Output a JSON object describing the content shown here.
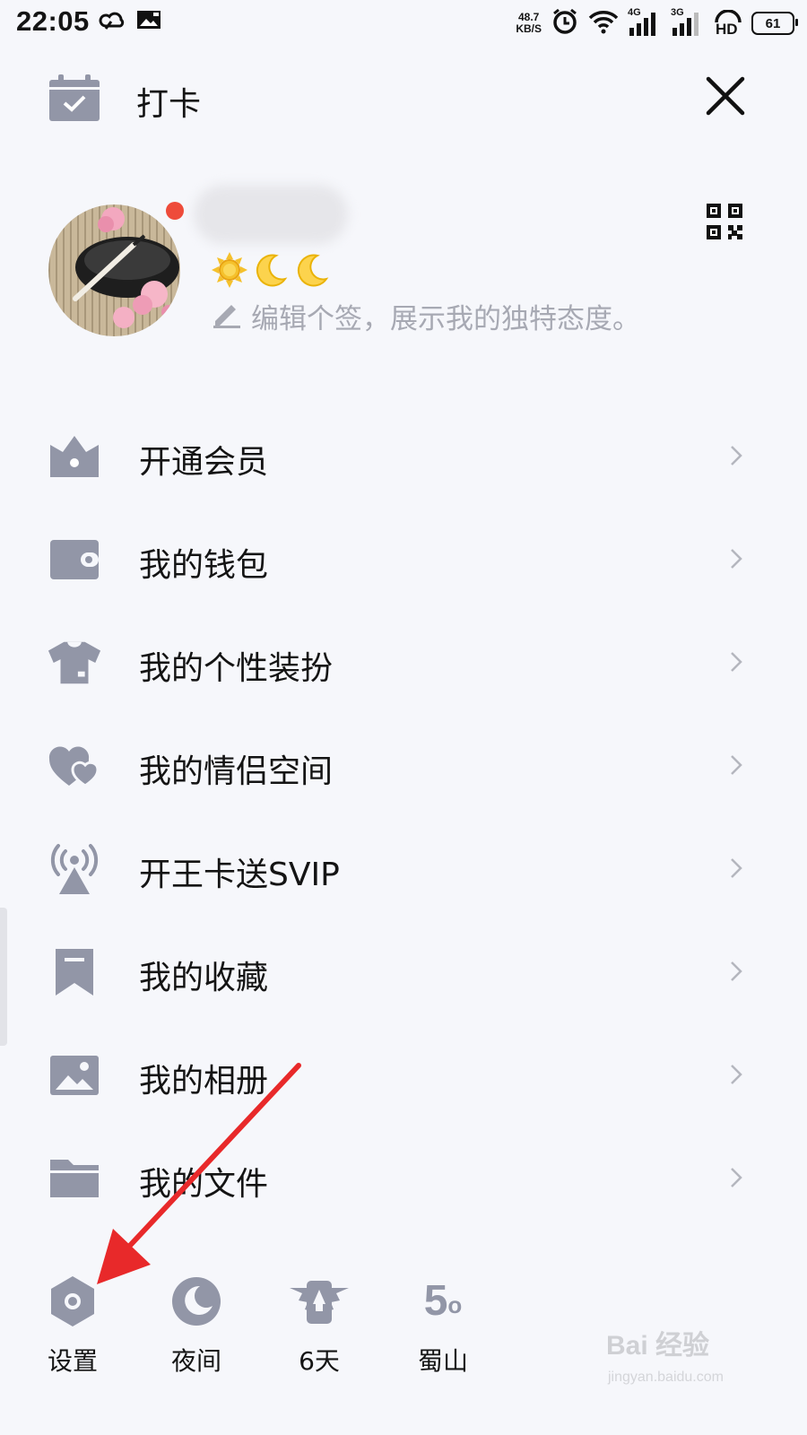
{
  "status_bar": {
    "time": "22:05",
    "net_speed_value": "48.7",
    "net_speed_unit": "KB/S",
    "signal1_label": "4G",
    "signal2_label": "3G",
    "hd_label": "HD",
    "battery": "61"
  },
  "header": {
    "checkin_label": "打卡"
  },
  "profile": {
    "signature_placeholder": "编辑个签，展示我的独特态度。",
    "level_icons": [
      "sun-icon",
      "moon-icon",
      "moon-icon"
    ]
  },
  "menu": {
    "items": [
      {
        "label": "开通会员",
        "icon": "crown-icon"
      },
      {
        "label": "我的钱包",
        "icon": "wallet-icon"
      },
      {
        "label": "我的个性装扮",
        "icon": "tshirt-icon"
      },
      {
        "label": "我的情侣空间",
        "icon": "hearts-icon"
      },
      {
        "label": "开王卡送SVIP",
        "icon": "signal-tower-icon"
      },
      {
        "label": "我的收藏",
        "icon": "bookmark-icon"
      },
      {
        "label": "我的相册",
        "icon": "image-icon"
      },
      {
        "label": "我的文件",
        "icon": "folder-icon"
      }
    ]
  },
  "bottom_bar": {
    "settings_label": "设置",
    "night_label": "夜间",
    "streak_label": "6天",
    "weather_temp": "5",
    "weather_degree": "o",
    "weather_city": "蜀山"
  },
  "colors": {
    "icon_gray": "#9296a7",
    "annotation_arrow": "#e8292a",
    "notification_dot": "#ee4b3a",
    "level_gold": "#f5c12c"
  },
  "watermark": {
    "brand": "Bai 经验",
    "url": "jingyan.baidu.com"
  }
}
